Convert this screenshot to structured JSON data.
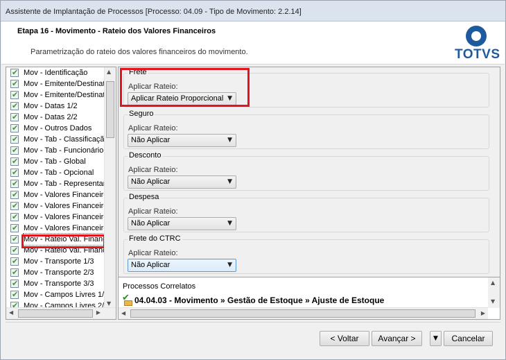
{
  "window": {
    "title": "Assistente de Implantação de Processos [Processo: 04.09 - Tipo de Movimento: 2.2.14]"
  },
  "header": {
    "step": "Etapa 16 - Movimento - Rateio dos Valores Financeiros",
    "description": "Parametrização do rateio dos valores financeiros do movimento.",
    "logo_text": "TOTVS",
    "brand_color": "#1d5a9e"
  },
  "steps": [
    {
      "label": "Mov - Identificação"
    },
    {
      "label": "Mov - Emitente/Destinat"
    },
    {
      "label": "Mov - Emitente/Destinat"
    },
    {
      "label": "Mov - Datas 1/2"
    },
    {
      "label": "Mov - Datas 2/2"
    },
    {
      "label": "Mov - Outros Dados"
    },
    {
      "label": "Mov - Tab - Classificação"
    },
    {
      "label": "Mov - Tab - Funcionário"
    },
    {
      "label": "Mov - Tab - Global"
    },
    {
      "label": "Mov - Tab - Opcional"
    },
    {
      "label": "Mov - Tab - Representan"
    },
    {
      "label": "Mov - Valores Financeiro"
    },
    {
      "label": "Mov - Valores Financeiro"
    },
    {
      "label": "Mov - Valores Financeiro"
    },
    {
      "label": "Mov - Valores Financeiro"
    },
    {
      "label": "Mov - Rateio Val. Financ"
    },
    {
      "label": "Mov - Rateio Val. Financ"
    },
    {
      "label": "Mov - Transporte 1/3"
    },
    {
      "label": "Mov - Transporte 2/3"
    },
    {
      "label": "Mov - Transporte 3/3"
    },
    {
      "label": "Mov - Campos Livres 1/2"
    },
    {
      "label": "Mov - Campos Livres 2/2"
    }
  ],
  "groups": [
    {
      "title": "Frete",
      "label": "Aplicar Rateio:",
      "value": "Aplicar Rateio Proporcional"
    },
    {
      "title": "Seguro",
      "label": "Aplicar Rateio:",
      "value": "Não Aplicar"
    },
    {
      "title": "Desconto",
      "label": "Aplicar Rateio:",
      "value": "Não Aplicar"
    },
    {
      "title": "Despesa",
      "label": "Aplicar Rateio:",
      "value": "Não Aplicar"
    },
    {
      "title": "Frete do CTRC",
      "label": "Aplicar Rateio:",
      "value": "Não Aplicar"
    }
  ],
  "related": {
    "title": "Processos Correlatos",
    "item": "04.04.03 - Movimento » Gestão de Estoque » Ajuste de Estoque"
  },
  "buttons": {
    "back": "< Voltar",
    "next": "Avançar >",
    "cancel": "Cancelar"
  },
  "highlight_color": "#e8121f"
}
